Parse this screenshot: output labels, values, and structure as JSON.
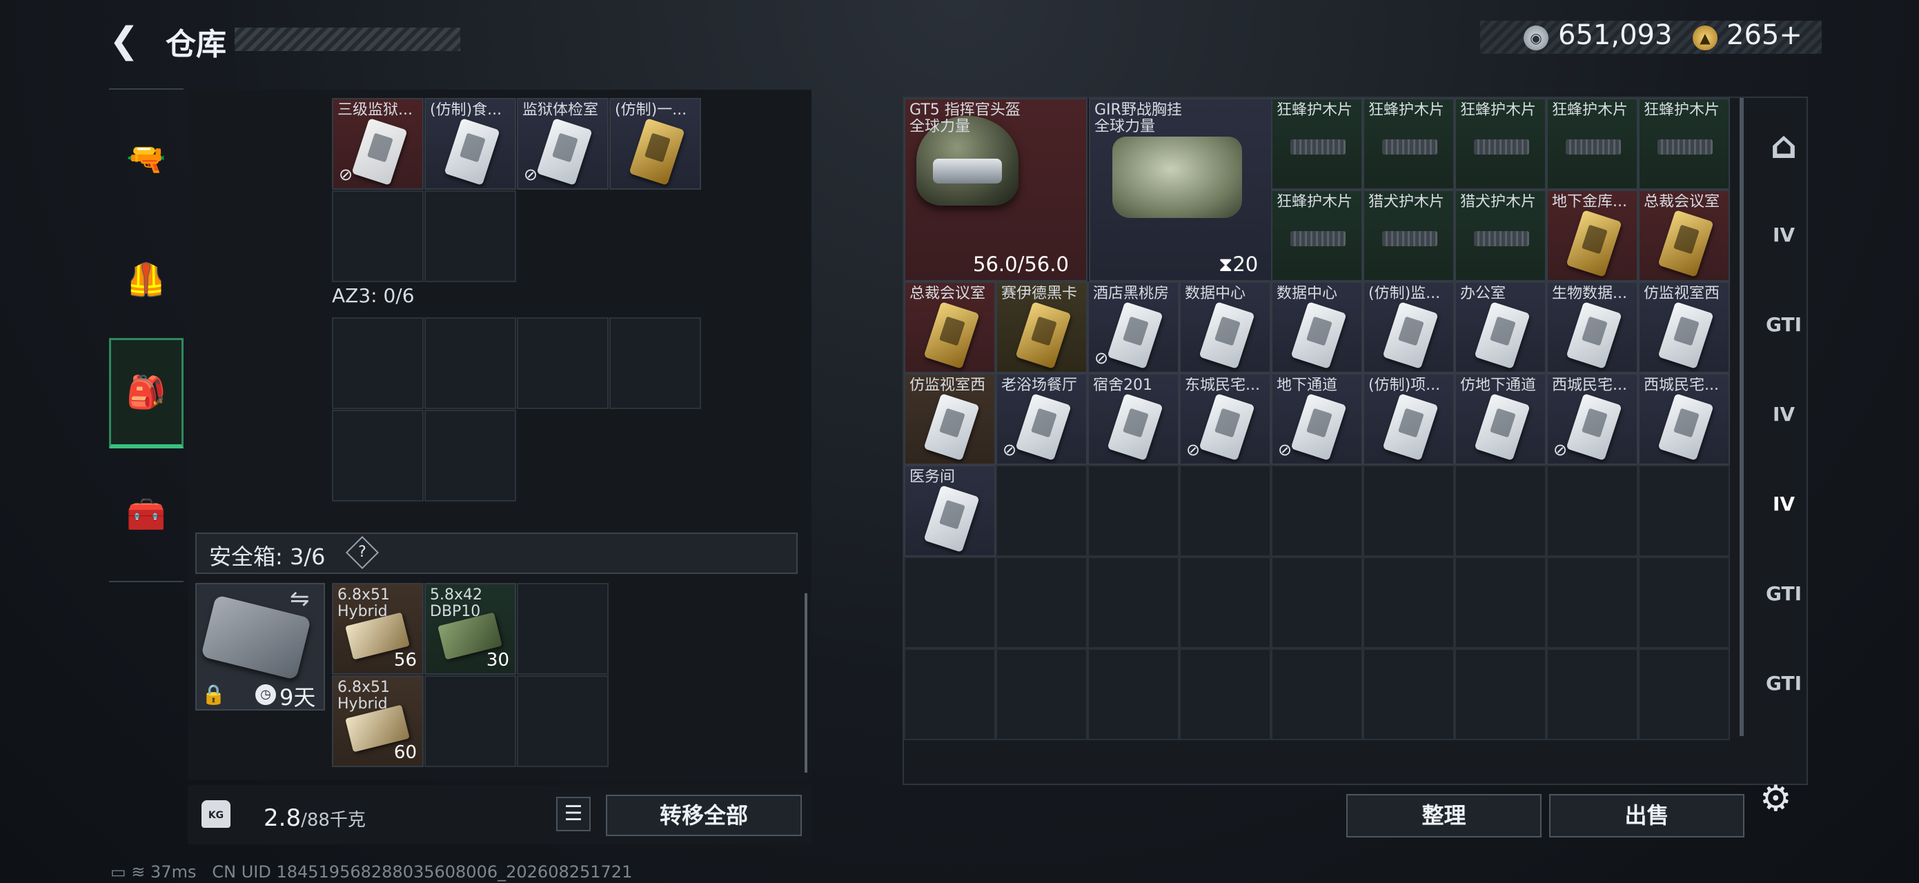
{
  "header": {
    "back_icon": "back-chevron-icon",
    "title": "仓库",
    "currency1": "651,093",
    "currency2": "265+",
    "coin1_icon": "silver-coin-icon",
    "coin2_icon": "gold-coin-icon"
  },
  "left_tabs": [
    {
      "name": "weapons",
      "icon": "pistol-icon",
      "glyph": "🔫"
    },
    {
      "name": "armor",
      "icon": "vest-icon",
      "glyph": "🦺"
    },
    {
      "name": "backpack",
      "icon": "backpack-icon",
      "glyph": "🎒",
      "active": true
    },
    {
      "name": "case",
      "icon": "toolbox-icon",
      "glyph": "🧰"
    }
  ],
  "left_items_top": [
    "三级监狱...",
    "(仿制)食...",
    "监狱体检室",
    "(仿制)一..."
  ],
  "az3_label": "AZ3: 0/6",
  "safe": {
    "label": "安全箱: 3/6",
    "help": "?",
    "days": "9天",
    "items": [
      {
        "name": "6.8x51 Hybrid",
        "count": "56"
      },
      {
        "name": "5.8x42 DBP10",
        "count": "30"
      },
      {
        "name": "6.8x51 Hybrid",
        "count": "60"
      }
    ]
  },
  "weight": {
    "current": "2.8",
    "max_unit": "/88千克",
    "icon_text": "KG"
  },
  "buttons": {
    "transfer_all": "转移全部",
    "sort": "整理",
    "sell": "出售",
    "list_icon": "☰"
  },
  "right_items": {
    "helmet": {
      "name": "GT5 指挥官头盔",
      "sub": "全球力量",
      "durability": "56.0/56.0"
    },
    "vest": {
      "name": "GIR野战胸挂",
      "sub": "全球力量",
      "capacity": "20"
    },
    "row1": [
      "狂蜂护木片",
      "狂蜂护木片",
      "狂蜂护木片",
      "狂蜂护木片",
      "狂蜂护木片"
    ],
    "row2": [
      "狂蜂护木片",
      "猎犬护木片",
      "猎犬护木片",
      "地下金库...",
      "总裁会议室"
    ],
    "row3": [
      "总裁会议室",
      "赛伊德黑卡",
      "酒店黑桃房",
      "数据中心",
      "数据中心",
      "(仿制)监...",
      "办公室",
      "生物数据...",
      "仿监视室西"
    ],
    "row4": [
      "仿监视室西",
      "老浴场餐厅",
      "宿舍201",
      "东城民宅...",
      "地下通道",
      "(仿制)项...",
      "仿地下通道",
      "西城民宅...",
      "西城民宅..."
    ],
    "row5": [
      "医务间"
    ]
  },
  "side_tabs": [
    {
      "label": "⌂"
    },
    {
      "label": "IV"
    },
    {
      "label": "GTI"
    },
    {
      "label": "IV"
    },
    {
      "label": "IV",
      "active": true
    },
    {
      "label": "GTI"
    },
    {
      "label": "GTI"
    }
  ],
  "status": {
    "ping": "37ms",
    "uid": "CN UID 1845195682880356080​06_202608251721"
  }
}
